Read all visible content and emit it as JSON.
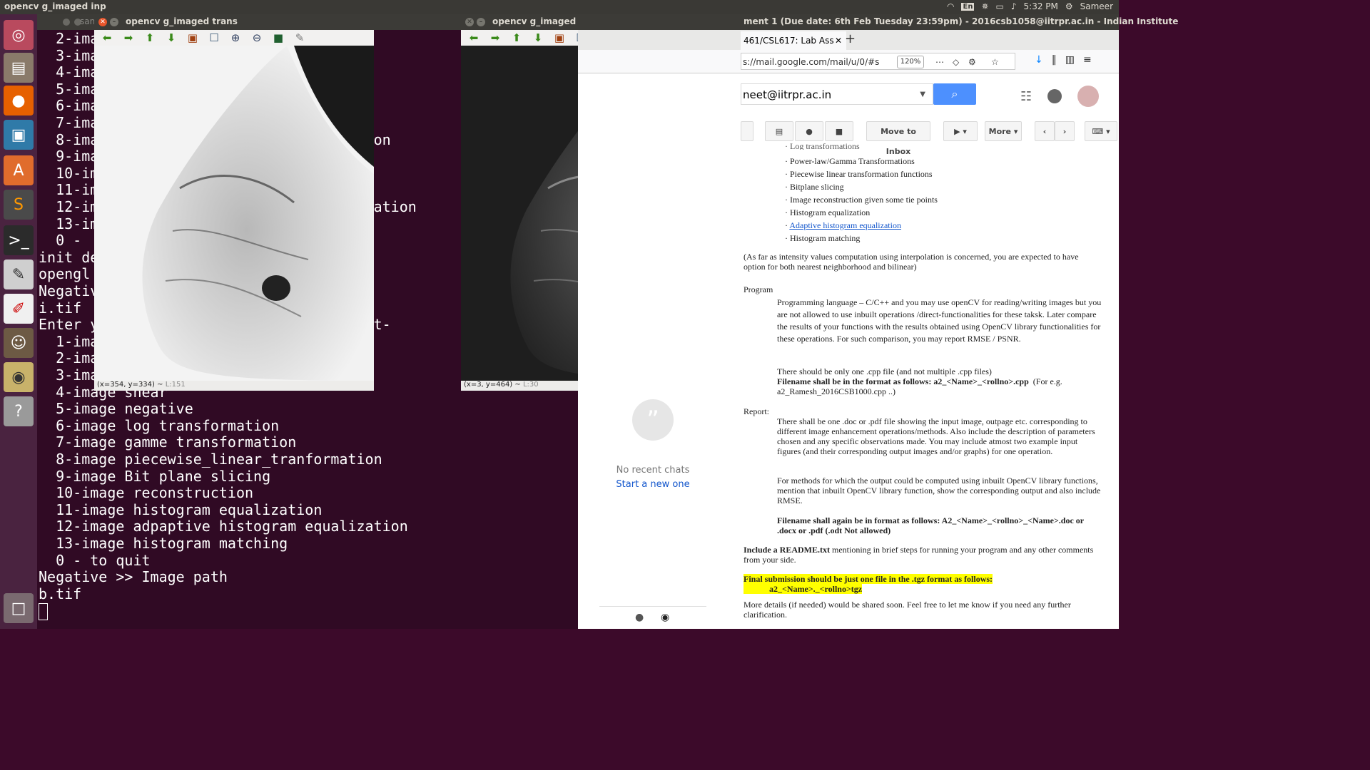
{
  "topbar": {
    "title": "opencv g_imaged inp",
    "lang": "En",
    "time": "5:32 PM",
    "user": "Sameer"
  },
  "launcher": {
    "items": [
      "ubuntu-logo",
      "files",
      "firefox",
      "workspace",
      "software-center",
      "sublime-text",
      "terminal",
      "text-editor",
      "document-viewer",
      "gimp",
      "image-viewer",
      "help",
      "trash"
    ]
  },
  "terminal": {
    "title": "san",
    "lines": [
      "  2-ima",
      "  3-ima",
      "  4-ima",
      "  5-ima",
      "  6-ima",
      "  7-ima",
      "  8-ima                                on",
      "  9-ima",
      "  10-im",
      "  11-im",
      "  12-im                                ation",
      "  13-im",
      "  0 - ",
      "init de",
      "opengl ",
      "Negativ",
      "i.tif",
      "Enter y                                t-",
      "  1-ima",
      "  2-ima",
      "  3-ima",
      "  4-image shear",
      "  5-image negative",
      "  6-image log transformation",
      "  7-image gamme transformation",
      "  8-image piecewise_linear_tranformation",
      "  9-image Bit plane slicing",
      "  10-image reconstruction",
      "  11-image histogram equalization",
      "  12-image adpaptive histogram equalization",
      "  13-image histogram matching",
      "  0 - to quit",
      "Negative >> Image path",
      "b.tif"
    ]
  },
  "cv_trans": {
    "title": "opencv g_imaged trans",
    "status_coords": "(x=354, y=334) ~",
    "status_level": "L:151"
  },
  "cv_inp": {
    "title": "opencv g_imaged inp",
    "status_coords": "(x=3, y=464) ~",
    "status_level": "L:30"
  },
  "browser": {
    "window_title": "ment 1 (Due date: 6th Feb Tuesday 23:59pm) - 2016csb1058@iitrpr.ac.in - Indian Institute",
    "tab_label": "461/CSL617: Lab Ass",
    "url": "s://mail.google.com/mail/u/0/#s",
    "zoom": "120%",
    "search_value": "neet@iitrpr.ac.in",
    "buttons": {
      "move_to_inbox": "Move to Inbox",
      "more": "More"
    },
    "chat": {
      "no_recent": "No recent chats",
      "start_new": "Start a new one"
    },
    "email": {
      "cut_top": "Log transformations",
      "bullets": [
        "Power-law/Gamma Transformations",
        "Piecewise linear transformation functions",
        "Bitplane slicing",
        "Image reconstruction given some tie points",
        "Histogram equalization",
        "Adaptive histogram equalization",
        "Histogram matching"
      ],
      "interp_note": "(As far as intensity values computation using interpolation is concerned, you are expected to have option for both nearest neighborhood and bilinear)",
      "program_label": "Program",
      "program_text": "Programming language – C/C++ and you may use openCV for reading/writing images but you are not allowed to use inbuilt operations /direct-functionalities for these taksk. Later compare the results of your functions with the results obtained using OpenCV library functionalities for these operations. For such comparison, you may report RMSE / PSNR.",
      "cpp_note": "There should be only one .cpp file (and not multiple .cpp files)",
      "filename_bold": "Filename shall be in the format as follows:       a2_<Name>_<rollno>.cpp",
      "filename_eg": "(For e.g. a2_Ramesh_2016CSB1000.cpp ..)",
      "report_label": "Report:",
      "report_text": "There shall be one .doc or .pdf file showing the input image, outpage etc. corresponding to different image enhancement operations/methods. Also include the description of parameters chosen and any specific observations made. You may include atmost two example input figures (and their corresponding output images and/or graphs) for one operation.",
      "opencv_methods": "For methods for which the output could be computed using inbuilt OpenCV library functions, mention that inbuilt OpenCV library function, show the corresponding output and also include RMSE.",
      "filename_again": "Filename shall again be in format as follows: A2_<Name>_<rollno>_<Name>.doc  or .docx or .pdf  (.odt Not allowed)",
      "readme_bold": "Include a README.txt",
      "readme_rest": " mentioning in brief steps for running your program and any other comments from your side.",
      "final_submission": "Final submission should be just one file in the .tgz format as follows:",
      "final_name": "a2_<Name>._<rollno>tgz",
      "more_details": "More details (if needed) would be shared soon. Feel free to let me know if you need any further clarification."
    }
  }
}
